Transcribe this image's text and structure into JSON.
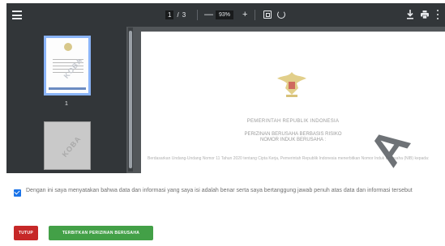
{
  "viewer": {
    "page_current": "1",
    "page_sep": "/",
    "page_total": "3",
    "zoom_minus": "—",
    "zoom_level": "93%",
    "zoom_plus": "+",
    "thumbnails": [
      {
        "watermark": "KOBA",
        "page_number": "1"
      },
      {
        "watermark": "KOBA"
      }
    ],
    "document": {
      "title": "PEMERINTAH REPUBLIK INDONESIA",
      "subtitle_line1": "PERIZINAN BERUSAHA BERBASIS RISIKO",
      "subtitle_line2": "NOMOR INDUK BERUSAHA : ",
      "body": "Berdasarkan Undang-Undang Nomor 11 Tahun 2020 tentang Cipta Kerja, Pemerintah Republik Indonesia menerbitkan Nomor Induk Berusaha (NIB) kepada:",
      "watermark": "A"
    }
  },
  "consent": {
    "checked": true,
    "text": "Dengan ini saya menyatakan bahwa data dan informasi yang saya isi adalah benar serta saya bertanggung jawab penuh atas data dan informasi tersebut"
  },
  "buttons": {
    "close_label": "TUTUP",
    "agree_label": "TERBITKAN PERIZINAN BERUSAHA"
  },
  "colors": {
    "toolbar": "#323639",
    "checkbox": "#1a73e8",
    "close_button": "#c62828",
    "agree_button": "#43a047"
  },
  "icons": [
    "menu-icon",
    "fit-page-icon",
    "rotate-icon",
    "download-icon",
    "print-icon",
    "more-options-icon"
  ]
}
